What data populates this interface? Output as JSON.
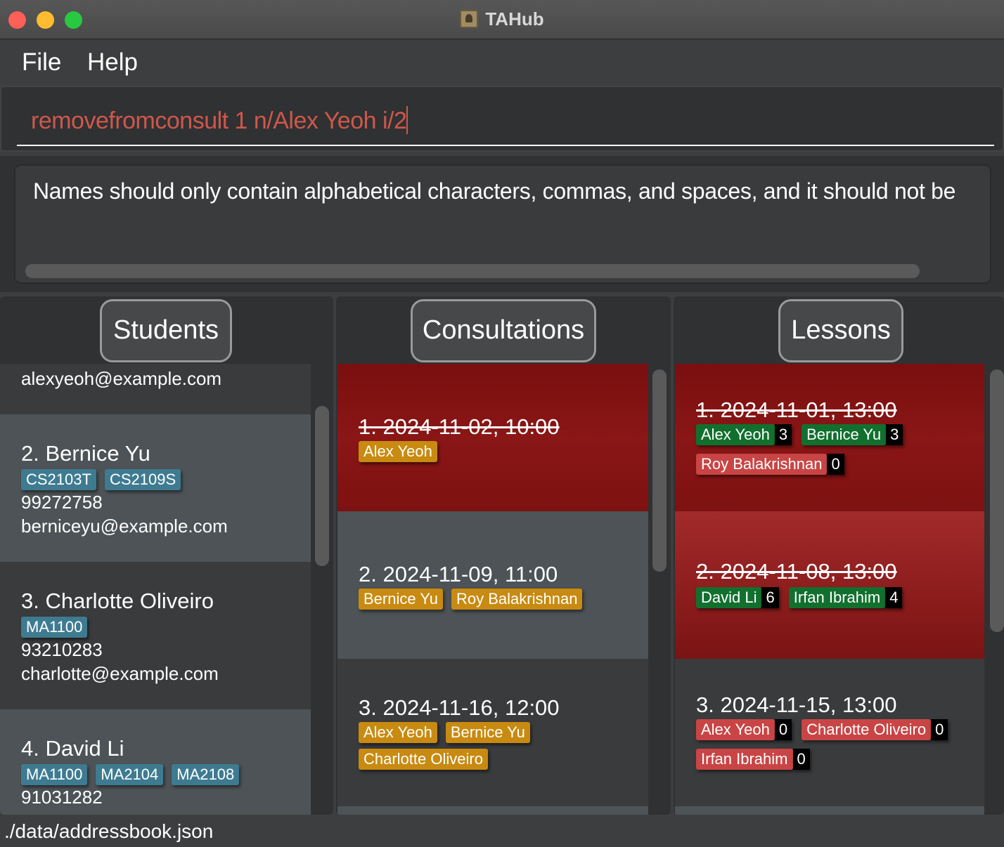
{
  "window": {
    "title": "TAHub"
  },
  "menu": {
    "file": "File",
    "help": "Help"
  },
  "command": {
    "value": "removefromconsult 1 n/Alex Yeoh i/2"
  },
  "result": {
    "text": "Names should only contain alphabetical characters, commas, and spaces, and it should not be"
  },
  "panels": {
    "students": "Students",
    "consultations": "Consultations",
    "lessons": "Lessons"
  },
  "students": {
    "s1": {
      "email": "alexyeoh@example.com"
    },
    "s2": {
      "name": "2. Bernice Yu",
      "tags": [
        "CS2103T",
        "CS2109S"
      ],
      "phone": "99272758",
      "email": "berniceyu@example.com"
    },
    "s3": {
      "name": "3. Charlotte Oliveiro",
      "tags": [
        "MA1100"
      ],
      "phone": "93210283",
      "email": "charlotte@example.com"
    },
    "s4": {
      "name": "4. David Li",
      "tags": [
        "MA1100",
        "MA2104",
        "MA2108"
      ],
      "phone": "91031282"
    }
  },
  "consultations": {
    "c1": {
      "title": "1. 2024-11-02, 10:00",
      "students": [
        "Alex Yeoh"
      ]
    },
    "c2": {
      "title": "2. 2024-11-09, 11:00",
      "students": [
        "Bernice Yu",
        "Roy Balakrishnan"
      ]
    },
    "c3": {
      "title": "3. 2024-11-16, 12:00",
      "students": [
        "Alex Yeoh",
        "Bernice Yu",
        "Charlotte Oliveiro"
      ]
    }
  },
  "lessons": {
    "l1": {
      "title": "1. 2024-11-01, 13:00",
      "attendees": [
        {
          "name": "Alex Yeoh",
          "count": "3",
          "status": "present"
        },
        {
          "name": "Bernice Yu",
          "count": "3",
          "status": "present"
        },
        {
          "name": "Roy Balakrishnan",
          "count": "0",
          "status": "absent"
        }
      ]
    },
    "l2": {
      "title": "2. 2024-11-08, 13:00",
      "attendees": [
        {
          "name": "David Li",
          "count": "6",
          "status": "present"
        },
        {
          "name": "Irfan Ibrahim",
          "count": "4",
          "status": "present"
        }
      ]
    },
    "l3": {
      "title": "3. 2024-11-15, 13:00",
      "attendees": [
        {
          "name": "Alex Yeoh",
          "count": "0",
          "status": "absent"
        },
        {
          "name": "Charlotte Oliveiro",
          "count": "0",
          "status": "absent"
        },
        {
          "name": "Irfan Ibrahim",
          "count": "0",
          "status": "absent"
        }
      ]
    }
  },
  "status": {
    "path": "./data/addressbook.json"
  },
  "colors": {
    "present": "#12702e",
    "absent": "#c94545",
    "consult_tag": "#c88a10",
    "module_tag": "#3e7b91",
    "command_text": "#d0574a"
  }
}
